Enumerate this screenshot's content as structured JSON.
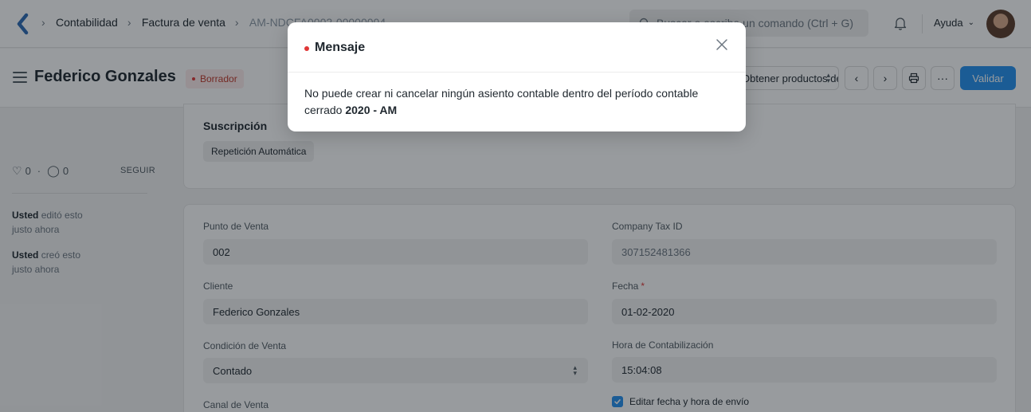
{
  "navbar": {
    "breadcrumbs": [
      "Contabilidad",
      "Factura de venta",
      "AM-NDCFA0002-00000004"
    ],
    "search_placeholder": "Buscar o escriba un comando (Ctrl + G)",
    "help_label": "Ayuda"
  },
  "page_head": {
    "title": "Federico Gonzales",
    "status": "Borrador",
    "get_items_label": "Obtener productos de",
    "submit_label": "Validar"
  },
  "sidebar": {
    "likes": "0",
    "comments": "0",
    "follow_label": "SEGUIR",
    "activity": [
      {
        "user": "Usted",
        "action": "editó esto",
        "time": "justo ahora"
      },
      {
        "user": "Usted",
        "action": "creó esto",
        "time": "justo ahora"
      }
    ]
  },
  "subscription": {
    "title": "Suscripción",
    "auto_repeat_label": "Repetición Automática"
  },
  "form": {
    "punto_venta": {
      "label": "Punto de Venta",
      "value": "002"
    },
    "company_tax_id": {
      "label": "Company Tax ID",
      "value": "307152481366"
    },
    "cliente": {
      "label": "Cliente",
      "value": "Federico Gonzales"
    },
    "fecha": {
      "label": "Fecha",
      "required_mark": "*",
      "value": "01-02-2020"
    },
    "condicion_venta": {
      "label": "Condición de Venta",
      "value": "Contado"
    },
    "hora_contab": {
      "label": "Hora de Contabilización",
      "value": "15:04:08"
    },
    "canal_venta": {
      "label": "Canal de Venta"
    },
    "editar_fecha": {
      "label": "Editar fecha y hora de envío",
      "checked": true
    }
  },
  "modal": {
    "title": "Mensaje",
    "message": "No puede crear ni cancelar ningún asiento contable dentro del período contable cerrado",
    "period": "2020 - AM"
  },
  "colors": {
    "primary": "#2490ef",
    "indicator_red": "#e03636",
    "overlay": "rgba(17,24,31,0.43)"
  }
}
